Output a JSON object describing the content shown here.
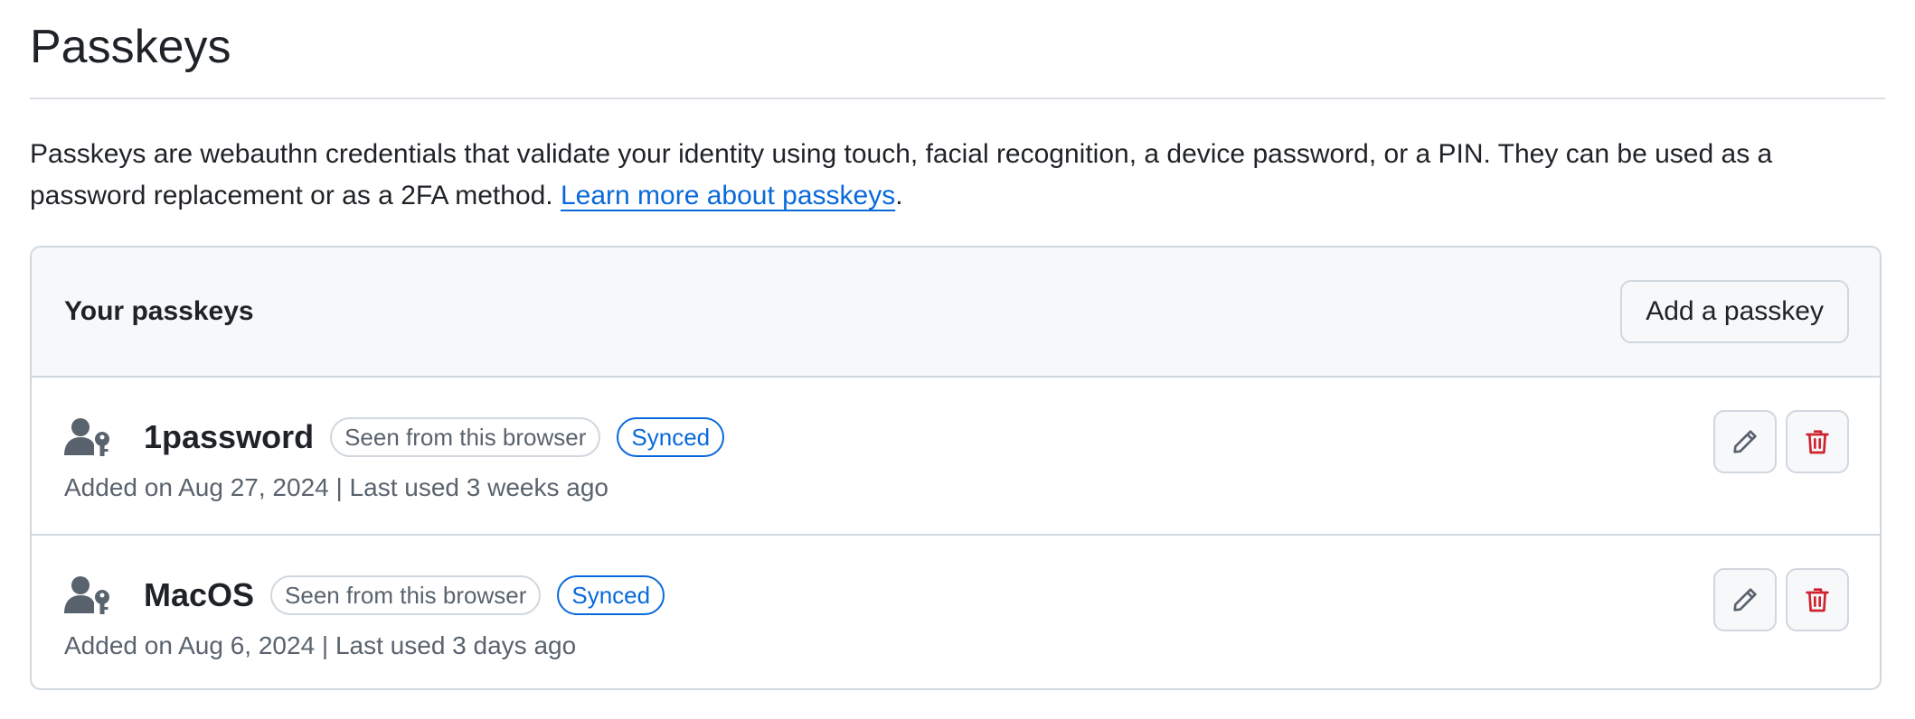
{
  "page": {
    "title": "Passkeys",
    "description": "Passkeys are webauthn credentials that validate your identity using touch, facial recognition, a device password, or a PIN. They can be used as a password replacement or as a 2FA method. ",
    "learn_more_link": "Learn more about passkeys",
    "description_end": "."
  },
  "box": {
    "title": "Your passkeys",
    "add_button_label": "Add a passkey"
  },
  "passkeys": [
    {
      "name": "1password",
      "badge_seen": "Seen from this browser",
      "badge_synced": "Synced",
      "meta": "Added on Aug 27, 2024 | Last used 3 weeks ago"
    },
    {
      "name": "MacOS",
      "badge_seen": "Seen from this browser",
      "badge_synced": "Synced",
      "meta": "Added on Aug 6, 2024 | Last used 3 days ago"
    }
  ],
  "icons": {
    "row_icon": "person-key-icon",
    "edit": "pencil-icon",
    "delete": "trash-icon"
  },
  "colors": {
    "link": "#0969da",
    "danger": "#cf222e",
    "muted": "#59636e",
    "border": "#d0d7de",
    "header_bg": "#f6f8fa"
  }
}
